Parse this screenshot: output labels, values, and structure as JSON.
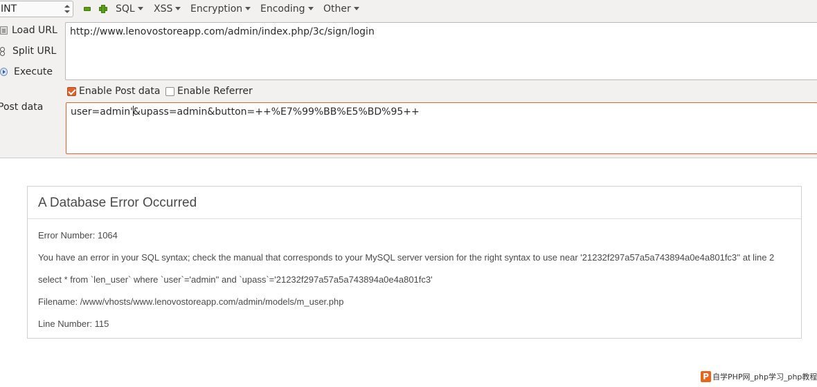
{
  "toolbar": {
    "select_value": "INT",
    "menus": [
      {
        "label": "SQL"
      },
      {
        "label": "XSS"
      },
      {
        "label": "Encryption"
      },
      {
        "label": "Encoding"
      },
      {
        "label": "Other"
      }
    ]
  },
  "side_buttons": {
    "load_url": "Load URL",
    "split_url": "Split URL",
    "execute": "Execute"
  },
  "url_field": {
    "value": "http://www.lenovostoreapp.com/admin/index.php/3c/sign/login"
  },
  "options": {
    "enable_post": {
      "label": "Enable Post data",
      "checked": true
    },
    "enable_referrer": {
      "label": "Enable Referrer",
      "checked": false
    }
  },
  "post_data": {
    "label": "Post data",
    "value_before_cursor": "user=admin'",
    "value_after_cursor": "&upass=admin&button=++%E7%99%BB%E5%BD%95++"
  },
  "error": {
    "title": "A Database Error Occurred",
    "lines": [
      "Error Number: 1064",
      "You have an error in your SQL syntax; check the manual that corresponds to your MySQL server version for the right syntax to use near '21232f297a57a5a743894a0e4a801fc3'' at line 2",
      "select * from `len_user` where `user`='admin'' and `upass`='21232f297a57a5a743894a0e4a801fc3'",
      "Filename: /www/vhosts/www.lenovostoreapp.com/admin/models/m_user.php",
      "Line Number: 115"
    ]
  },
  "watermark": {
    "logo": "P",
    "text": "自学PHP网_php学习_php教程"
  },
  "colors": {
    "accent_orange": "#e0632f",
    "icon_green": "#5b9e1a",
    "panel_bg": "#f2f1f0"
  }
}
